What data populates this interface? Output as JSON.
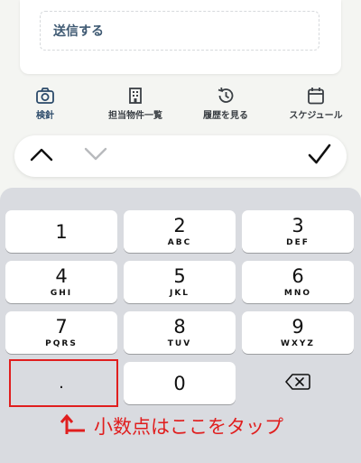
{
  "form": {
    "send_label": "送信する"
  },
  "tabs": [
    {
      "label": "検針",
      "icon": "camera-icon",
      "active": true
    },
    {
      "label": "担当物件一覧",
      "icon": "building-icon",
      "active": false
    },
    {
      "label": "履歴を見る",
      "icon": "history-icon",
      "active": false
    },
    {
      "label": "スケジュール",
      "icon": "calendar-icon",
      "active": false
    }
  ],
  "accessory": {
    "prev_icon": "chevron-up-icon",
    "next_icon": "chevron-down-icon",
    "done_icon": "checkmark-icon"
  },
  "keypad": {
    "keys": [
      {
        "num": "1",
        "letters": ""
      },
      {
        "num": "2",
        "letters": "ABC"
      },
      {
        "num": "3",
        "letters": "DEF"
      },
      {
        "num": "4",
        "letters": "GHI"
      },
      {
        "num": "5",
        "letters": "JKL"
      },
      {
        "num": "6",
        "letters": "MNO"
      },
      {
        "num": "7",
        "letters": "PQRS"
      },
      {
        "num": "8",
        "letters": "TUV"
      },
      {
        "num": "9",
        "letters": "WXYZ"
      },
      {
        "num": ".",
        "letters": ""
      },
      {
        "num": "0",
        "letters": ""
      }
    ],
    "delete_icon": "backspace-icon"
  },
  "annotation": {
    "text": "小数点はここをタップ",
    "color": "#e01e1e",
    "arrow_icon": "arrow-up-corner-icon"
  },
  "colors": {
    "accent": "#2b4a6a",
    "keyboard_bg": "#d9dbe0",
    "annotation": "#e01e1e"
  }
}
